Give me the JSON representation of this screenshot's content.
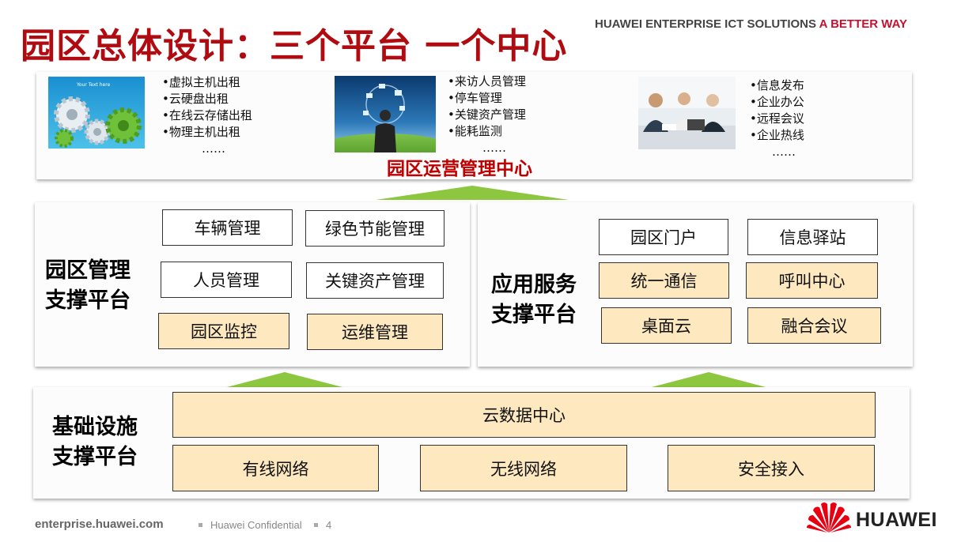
{
  "header": {
    "title": "园区总体设计：三个平台 一个中心",
    "tagline_main": "HUAWEI ENTERPRISE ICT SOLUTIONS ",
    "tagline_accent": "A BETTER WAY"
  },
  "operations_center": {
    "label": "园区运营管理中心",
    "groups": [
      {
        "image": "gears-image",
        "image_text": "Your Text here",
        "items": [
          "•虚拟主机出租",
          "•云硬盘出租",
          "•在线云存储出租",
          "•物理主机出租"
        ],
        "more": "……"
      },
      {
        "image": "businessman-cloud-image",
        "items": [
          "•来访人员管理",
          "•停车管理",
          "•关键资产管理",
          "•能耗监测"
        ],
        "more": "……"
      },
      {
        "image": "meeting-image",
        "items": [
          "•信息发布",
          "•企业办公",
          "•远程会议",
          "•企业热线"
        ],
        "more": "……"
      }
    ]
  },
  "management_platform": {
    "label_line1": "园区管理",
    "label_line2": "支撑平台",
    "boxes": [
      "车辆管理",
      "绿色节能管理",
      "人员管理",
      "关键资产管理",
      "园区监控",
      "运维管理"
    ]
  },
  "application_platform": {
    "label_line1": "应用服务",
    "label_line2": "支撑平台",
    "boxes": [
      "园区门户",
      "信息驿站",
      "统一通信",
      "呼叫中心",
      "桌面云",
      "融合会议"
    ]
  },
  "infrastructure_platform": {
    "label_line1": "基础设施",
    "label_line2": "支撑平台",
    "boxes": [
      "云数据中心",
      "有线网络",
      "无线网络",
      "安全接入"
    ]
  },
  "footer": {
    "url": "enterprise.huawei.com",
    "confidential": "Huawei Confidential",
    "page": "4",
    "brand": "HUAWEI"
  },
  "colors": {
    "title": "#b00b10",
    "accent": "#c8102e",
    "center_label": "#c00000",
    "highlight_box": "#fde8bf",
    "arrow": "#8dc63f"
  }
}
